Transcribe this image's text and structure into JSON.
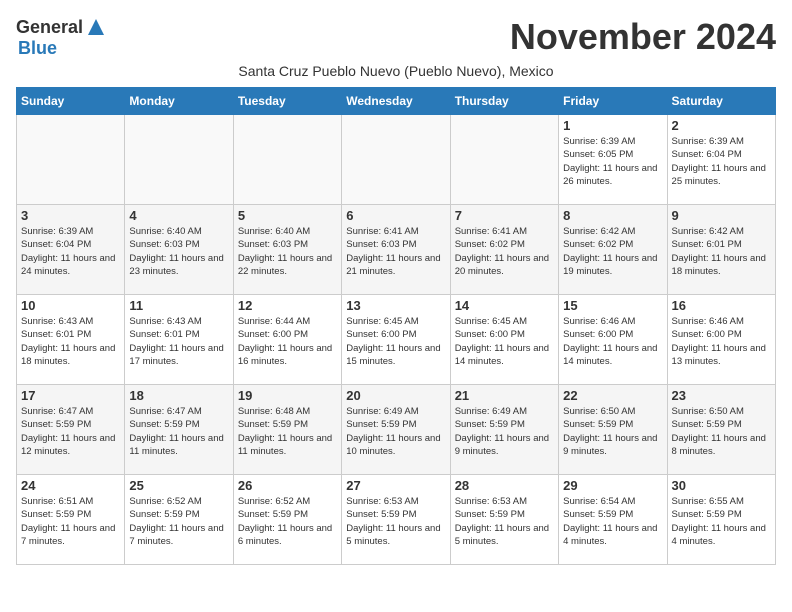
{
  "header": {
    "logo_general": "General",
    "logo_blue": "Blue",
    "month_title": "November 2024",
    "subtitle": "Santa Cruz Pueblo Nuevo (Pueblo Nuevo), Mexico"
  },
  "days_of_week": [
    "Sunday",
    "Monday",
    "Tuesday",
    "Wednesday",
    "Thursday",
    "Friday",
    "Saturday"
  ],
  "weeks": [
    [
      {
        "day": "",
        "content": ""
      },
      {
        "day": "",
        "content": ""
      },
      {
        "day": "",
        "content": ""
      },
      {
        "day": "",
        "content": ""
      },
      {
        "day": "",
        "content": ""
      },
      {
        "day": "1",
        "content": "Sunrise: 6:39 AM\nSunset: 6:05 PM\nDaylight: 11 hours and 26 minutes."
      },
      {
        "day": "2",
        "content": "Sunrise: 6:39 AM\nSunset: 6:04 PM\nDaylight: 11 hours and 25 minutes."
      }
    ],
    [
      {
        "day": "3",
        "content": "Sunrise: 6:39 AM\nSunset: 6:04 PM\nDaylight: 11 hours and 24 minutes."
      },
      {
        "day": "4",
        "content": "Sunrise: 6:40 AM\nSunset: 6:03 PM\nDaylight: 11 hours and 23 minutes."
      },
      {
        "day": "5",
        "content": "Sunrise: 6:40 AM\nSunset: 6:03 PM\nDaylight: 11 hours and 22 minutes."
      },
      {
        "day": "6",
        "content": "Sunrise: 6:41 AM\nSunset: 6:03 PM\nDaylight: 11 hours and 21 minutes."
      },
      {
        "day": "7",
        "content": "Sunrise: 6:41 AM\nSunset: 6:02 PM\nDaylight: 11 hours and 20 minutes."
      },
      {
        "day": "8",
        "content": "Sunrise: 6:42 AM\nSunset: 6:02 PM\nDaylight: 11 hours and 19 minutes."
      },
      {
        "day": "9",
        "content": "Sunrise: 6:42 AM\nSunset: 6:01 PM\nDaylight: 11 hours and 18 minutes."
      }
    ],
    [
      {
        "day": "10",
        "content": "Sunrise: 6:43 AM\nSunset: 6:01 PM\nDaylight: 11 hours and 18 minutes."
      },
      {
        "day": "11",
        "content": "Sunrise: 6:43 AM\nSunset: 6:01 PM\nDaylight: 11 hours and 17 minutes."
      },
      {
        "day": "12",
        "content": "Sunrise: 6:44 AM\nSunset: 6:00 PM\nDaylight: 11 hours and 16 minutes."
      },
      {
        "day": "13",
        "content": "Sunrise: 6:45 AM\nSunset: 6:00 PM\nDaylight: 11 hours and 15 minutes."
      },
      {
        "day": "14",
        "content": "Sunrise: 6:45 AM\nSunset: 6:00 PM\nDaylight: 11 hours and 14 minutes."
      },
      {
        "day": "15",
        "content": "Sunrise: 6:46 AM\nSunset: 6:00 PM\nDaylight: 11 hours and 14 minutes."
      },
      {
        "day": "16",
        "content": "Sunrise: 6:46 AM\nSunset: 6:00 PM\nDaylight: 11 hours and 13 minutes."
      }
    ],
    [
      {
        "day": "17",
        "content": "Sunrise: 6:47 AM\nSunset: 5:59 PM\nDaylight: 11 hours and 12 minutes."
      },
      {
        "day": "18",
        "content": "Sunrise: 6:47 AM\nSunset: 5:59 PM\nDaylight: 11 hours and 11 minutes."
      },
      {
        "day": "19",
        "content": "Sunrise: 6:48 AM\nSunset: 5:59 PM\nDaylight: 11 hours and 11 minutes."
      },
      {
        "day": "20",
        "content": "Sunrise: 6:49 AM\nSunset: 5:59 PM\nDaylight: 11 hours and 10 minutes."
      },
      {
        "day": "21",
        "content": "Sunrise: 6:49 AM\nSunset: 5:59 PM\nDaylight: 11 hours and 9 minutes."
      },
      {
        "day": "22",
        "content": "Sunrise: 6:50 AM\nSunset: 5:59 PM\nDaylight: 11 hours and 9 minutes."
      },
      {
        "day": "23",
        "content": "Sunrise: 6:50 AM\nSunset: 5:59 PM\nDaylight: 11 hours and 8 minutes."
      }
    ],
    [
      {
        "day": "24",
        "content": "Sunrise: 6:51 AM\nSunset: 5:59 PM\nDaylight: 11 hours and 7 minutes."
      },
      {
        "day": "25",
        "content": "Sunrise: 6:52 AM\nSunset: 5:59 PM\nDaylight: 11 hours and 7 minutes."
      },
      {
        "day": "26",
        "content": "Sunrise: 6:52 AM\nSunset: 5:59 PM\nDaylight: 11 hours and 6 minutes."
      },
      {
        "day": "27",
        "content": "Sunrise: 6:53 AM\nSunset: 5:59 PM\nDaylight: 11 hours and 5 minutes."
      },
      {
        "day": "28",
        "content": "Sunrise: 6:53 AM\nSunset: 5:59 PM\nDaylight: 11 hours and 5 minutes."
      },
      {
        "day": "29",
        "content": "Sunrise: 6:54 AM\nSunset: 5:59 PM\nDaylight: 11 hours and 4 minutes."
      },
      {
        "day": "30",
        "content": "Sunrise: 6:55 AM\nSunset: 5:59 PM\nDaylight: 11 hours and 4 minutes."
      }
    ]
  ]
}
